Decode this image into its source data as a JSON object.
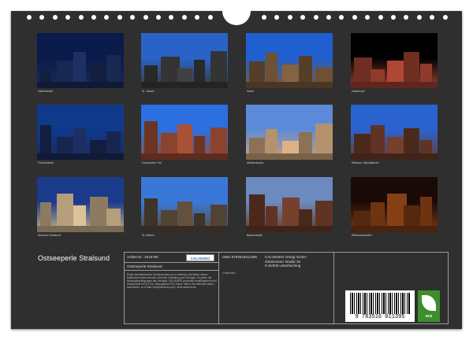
{
  "calendar": {
    "title": "Ostseeperle Stralsund",
    "photos": [
      {
        "caption": "Hafenstraße",
        "sky": "#0a1a4a",
        "ground": "#1a2c5a"
      },
      {
        "caption": "St. Jakobi",
        "sky": "#2a63c8",
        "ground": "#3a3a3a"
      },
      {
        "caption": "Markt",
        "sky": "#1f5fd0",
        "ground": "#7a5a3a"
      },
      {
        "caption": "Hafeninsel",
        "sky": "#000000",
        "ground": "#a04030"
      },
      {
        "caption": "Frankenteich",
        "sky": "#0f3a8c",
        "ground": "#1a2a5a"
      },
      {
        "caption": "Kampischer Hof",
        "sky": "#2b6fe0",
        "ground": "#9a4a32"
      },
      {
        "caption": "Mühlenstraße",
        "sky": "#5b8bd8",
        "ground": "#c9a27a"
      },
      {
        "caption": "Rathaus, Nikolaikirche",
        "sky": "#2a63d0",
        "ground": "#6a3a2a"
      },
      {
        "caption": "Museum Stralsund",
        "sky": "#1a3a8c",
        "ground": "#c8b08a"
      },
      {
        "caption": "St. Marien",
        "sky": "#3a78d8",
        "ground": "#5a4a3a"
      },
      {
        "caption": "Badenstraße",
        "sky": "#6a8ac0",
        "ground": "#6a3a28"
      },
      {
        "caption": "Rathausarkaden",
        "sky": "#1a0a06",
        "ground": "#7a3a14"
      }
    ],
    "back": {
      "article_no": "Artikel-Nr.: 2015755",
      "publisher_logo": "CALVENDO",
      "calendar_name": "Ostseeperle Stralsund",
      "description": "Einige bereitstehender Schutzvermerk ist so unterlegt, das Bildes dieses Kalenders fordes kommen und einer Gestaltung des Verlages. Es gelten die Nutzungsbedingungen des Verlages. CALVENDO produziert bedarfsgerecht und klimaneutral in DE & EU. Bezugspreis FSC Papier. Wenn Sie Interesse haben, aufzutreten, so & Mail: info@calvendo.com | www.calvendo.de",
      "isbn": "ISBN 9783516011395",
      "edition_code": "4 Bce/Vol41",
      "publisher_lines": [
        "CALVENDO Verlag GmbH",
        "Ottobrunner Straße 39",
        "D-82008 Unterhaching"
      ],
      "barcode_number": "9 783516 011395",
      "eco_label": "eco"
    }
  }
}
